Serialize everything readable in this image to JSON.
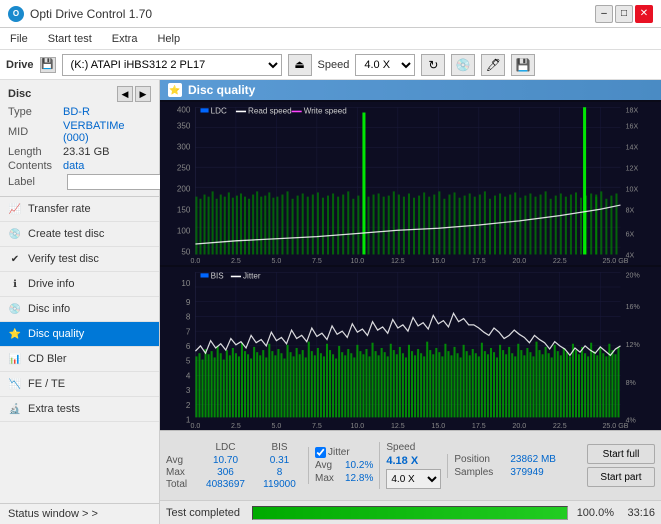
{
  "app": {
    "title": "Opti Drive Control 1.70",
    "icon": "O"
  },
  "title_controls": {
    "minimize": "–",
    "maximize": "□",
    "close": "✕"
  },
  "menu": {
    "items": [
      "File",
      "Start test",
      "Extra",
      "Help"
    ]
  },
  "drive_bar": {
    "label": "Drive",
    "drive_value": "(K:)  ATAPI iHBS312  2 PL17",
    "speed_label": "Speed",
    "speed_value": "4.0 X"
  },
  "disc": {
    "title": "Disc",
    "type_label": "Type",
    "type_value": "BD-R",
    "mid_label": "MID",
    "mid_value": "VERBATIMe (000)",
    "length_label": "Length",
    "length_value": "23.31 GB",
    "contents_label": "Contents",
    "contents_value": "data",
    "label_label": "Label",
    "label_value": ""
  },
  "nav": {
    "items": [
      {
        "id": "transfer-rate",
        "label": "Transfer rate",
        "icon": "📈"
      },
      {
        "id": "create-test-disc",
        "label": "Create test disc",
        "icon": "💿"
      },
      {
        "id": "verify-test-disc",
        "label": "Verify test disc",
        "icon": "✔"
      },
      {
        "id": "drive-info",
        "label": "Drive info",
        "icon": "ℹ"
      },
      {
        "id": "disc-info",
        "label": "Disc info",
        "icon": "💿"
      },
      {
        "id": "disc-quality",
        "label": "Disc quality",
        "icon": "⭐",
        "active": true
      },
      {
        "id": "cd-bler",
        "label": "CD Bler",
        "icon": "📊"
      },
      {
        "id": "fe-te",
        "label": "FE / TE",
        "icon": "📉"
      },
      {
        "id": "extra-tests",
        "label": "Extra tests",
        "icon": "🔬"
      }
    ]
  },
  "status_window": {
    "label": "Status window > >"
  },
  "quality_panel": {
    "title": "Disc quality",
    "legend": {
      "ldc": "LDC",
      "read_speed": "Read speed",
      "write_speed": "Write speed"
    },
    "legend2": {
      "bis": "BIS",
      "jitter": "Jitter"
    }
  },
  "stats": {
    "col_ldc": "LDC",
    "col_bis": "BIS",
    "col_jitter": "Jitter",
    "row_avg": "Avg",
    "row_max": "Max",
    "row_total": "Total",
    "avg_ldc": "10.70",
    "avg_bis": "0.31",
    "avg_jitter": "10.2%",
    "max_ldc": "306",
    "max_bis": "8",
    "max_jitter": "12.8%",
    "total_ldc": "4083697",
    "total_bis": "119000",
    "speed_label": "Speed",
    "speed_current": "4.18 X",
    "speed_select": "4.0 X",
    "position_label": "Position",
    "position_value": "23862 MB",
    "samples_label": "Samples",
    "samples_value": "379949",
    "jitter_checked": true
  },
  "buttons": {
    "start_full": "Start full",
    "start_part": "Start part"
  },
  "progress": {
    "label": "Test completed",
    "percent": "100.0%",
    "fill": 100,
    "time": "33:16"
  },
  "x_axis_labels": [
    "0.0",
    "2.5",
    "5.0",
    "7.5",
    "10.0",
    "12.5",
    "15.0",
    "17.5",
    "20.0",
    "22.5",
    "25.0"
  ],
  "chart1_y_labels": [
    "50",
    "100",
    "150",
    "200",
    "250",
    "300",
    "350",
    "400"
  ],
  "chart1_y_right": [
    "4X",
    "6X",
    "8X",
    "10X",
    "12X",
    "14X",
    "16X",
    "18X"
  ],
  "chart2_y_labels": [
    "1",
    "2",
    "3",
    "4",
    "5",
    "6",
    "7",
    "8",
    "9",
    "10"
  ],
  "chart2_y_right": [
    "4%",
    "8%",
    "12%",
    "16%",
    "20%"
  ]
}
